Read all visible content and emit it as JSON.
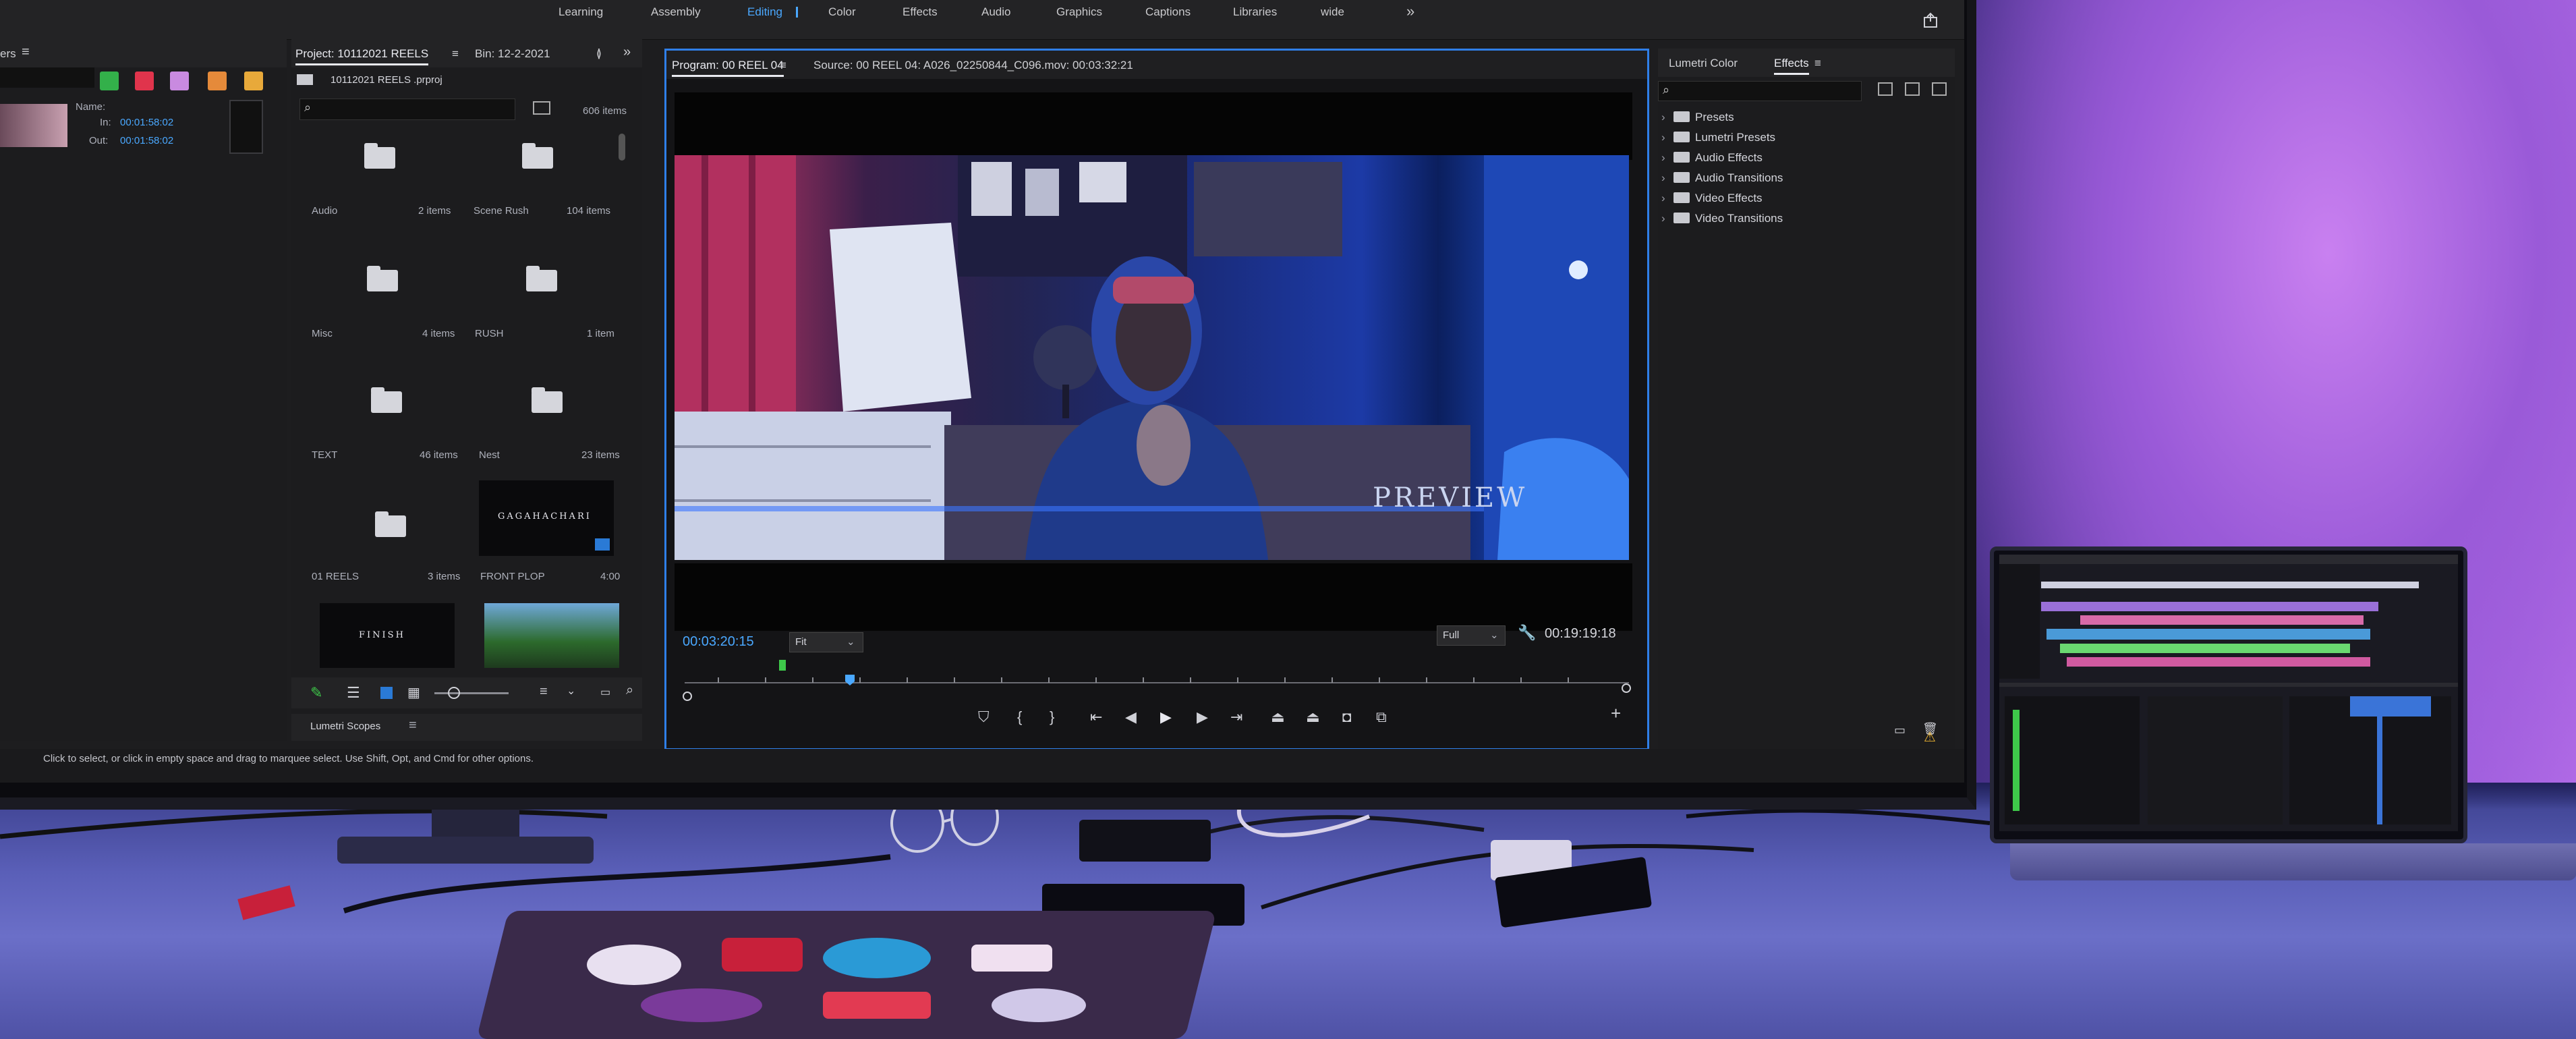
{
  "workspace_tabs": [
    "Learning",
    "Assembly",
    "Editing",
    "Color",
    "Effects",
    "Audio",
    "Graphics",
    "Captions",
    "Libraries",
    "wide"
  ],
  "workspace_more": "»",
  "left_panel": {
    "tab_label": "ers",
    "name_label": "Name:",
    "in_label": "In:",
    "in_value": "00:01:58:02",
    "out_label": "Out:",
    "out_value": "00:01:58:02",
    "swatch_colors": [
      "#33b04a",
      "#e0344c",
      "#c98ae0",
      "#e58a3a",
      "#e8a93a"
    ]
  },
  "project_panel": {
    "tab_project": "Project: 10112021 REELS",
    "tab_bin": "Bin: 12-2-2021",
    "file_name": "10112021 REELS .prproj",
    "search_placeholder": "",
    "item_count": "606 items",
    "items": [
      {
        "name": "Audio",
        "count": "2 items"
      },
      {
        "name": "Scene Rush",
        "count": "104 items"
      },
      {
        "name": "Misc",
        "count": "4 items"
      },
      {
        "name": "RUSH",
        "count": "1 item"
      },
      {
        "name": "TEXT",
        "count": "46 items"
      },
      {
        "name": "Nest",
        "count": "23 items"
      },
      {
        "name": "01 REELS",
        "count": "3 items"
      },
      {
        "name": "FRONT PLOP",
        "count": "4:00"
      }
    ],
    "thumb_title_1": "GAGAHACHARI",
    "thumb_title_2": "FINISH",
    "lumetri_scopes": "Lumetri Scopes"
  },
  "program_monitor": {
    "tab_program": "Program: 00 REEL 04",
    "tab_source": "Source: 00 REEL 04: A026_02250844_C096.mov: 00:03:32:21",
    "timecode_current": "00:03:20:15",
    "fit_label": "Fit",
    "full_label": "Full",
    "timecode_duration": "00:19:19:18",
    "watermark": "PREVIEW"
  },
  "effects_panel": {
    "tab_lumetri": "Lumetri Color",
    "tab_effects": "Effects",
    "items": [
      "Presets",
      "Lumetri Presets",
      "Audio Effects",
      "Audio Transitions",
      "Video Effects",
      "Video Transitions"
    ]
  },
  "status_bar": "Click to select, or click in empty space and drag to marquee select. Use Shift, Opt, and Cmd for other options.",
  "colors": {
    "accent": "#4aa8ff",
    "panel": "#1c1c1e",
    "header": "#232325",
    "wall_light": "#b06ae6"
  }
}
